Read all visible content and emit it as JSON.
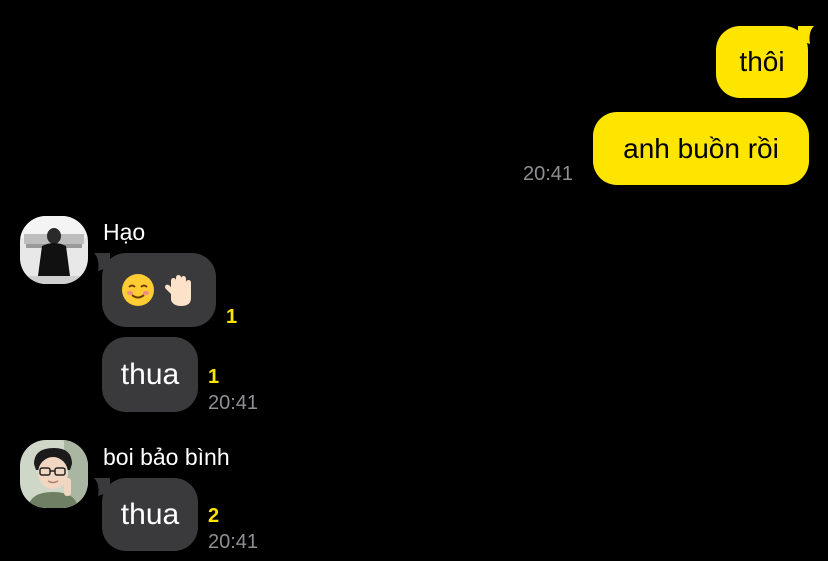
{
  "messages_out": [
    {
      "text": "thôi"
    },
    {
      "text": "anh buồn rồi",
      "time": "20:41"
    }
  ],
  "group_hao": {
    "sender": "Hạo",
    "avatar_icon": "user-avatar-photo",
    "emoji_message": {
      "icons": [
        "smiling-face-emoji",
        "raised-hand-emoji"
      ],
      "unread": "1"
    },
    "text_message": {
      "text": "thua",
      "unread": "1",
      "time": "20:41"
    }
  },
  "group_boi": {
    "sender": "boi bảo bình",
    "avatar_icon": "user-avatar-photo",
    "text_message": {
      "text": "thua",
      "unread": "2",
      "time": "20:41"
    }
  },
  "colors": {
    "background": "#000000",
    "outgoing_bubble": "#fee500",
    "incoming_bubble": "#3a3a3c",
    "unread_count": "#fee500",
    "timestamp": "#8e8e93"
  }
}
